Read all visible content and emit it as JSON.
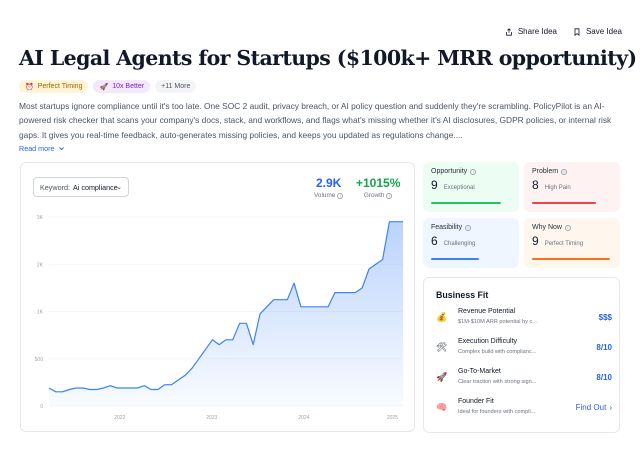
{
  "actions": {
    "share": "Share Idea",
    "save": "Save Idea"
  },
  "title": "AI Legal Agents for Startups ($100k+ MRR opportunity)",
  "badges": [
    {
      "icon": "alarm-clock-icon",
      "label": "Perfect Timing"
    },
    {
      "icon": "rocket-icon",
      "label": "10x Better"
    },
    {
      "label": "+11 More"
    }
  ],
  "description": "Most startups ignore compliance until it's too late. One SOC 2 audit, privacy breach, or AI policy question and suddenly they're scrambling. PolicyPilot is an AI-powered risk checker that scans your company's docs, stack, and workflows, and flags what's missing whether it's AI disclosures, GDPR policies, or internal risk gaps. It gives you real-time feedback, auto-generates missing policies, and keeps you updated as regulations change....",
  "read_more": "Read more",
  "trend": {
    "keyword_label": "Keyword:",
    "keyword_value": "Ai compliance",
    "volume_value": "2.9K",
    "volume_label": "Volume",
    "growth_value": "+1015%",
    "growth_label": "Growth"
  },
  "chart_data": {
    "type": "area",
    "y_ticks": [
      "3K",
      "2K",
      "1K",
      "500",
      "0"
    ],
    "x_ticks": [
      "2022",
      "2023",
      "2024",
      "2025"
    ],
    "color": "#3b82f6",
    "values": [
      380,
      300,
      300,
      350,
      380,
      380,
      350,
      350,
      380,
      430,
      380,
      380,
      380,
      380,
      430,
      350,
      350,
      450,
      450,
      550,
      650,
      800,
      1000,
      1200,
      1400,
      1300,
      1400,
      1400,
      1750,
      1750,
      1300,
      1950,
      2100,
      2250,
      2250,
      2250,
      2600,
      2100,
      2100,
      2100,
      2100,
      2100,
      2400,
      2400,
      2400,
      2400,
      2500,
      2900,
      3000,
      3100,
      3900,
      3900,
      3900
    ]
  },
  "scores": {
    "opportunity": {
      "title": "Opportunity",
      "value": "9",
      "label": "Exceptional"
    },
    "problem": {
      "title": "Problem",
      "value": "8",
      "label": "High Pain"
    },
    "feasibility": {
      "title": "Feasibility",
      "value": "6",
      "label": "Challenging"
    },
    "why_now": {
      "title": "Why Now",
      "value": "9",
      "label": "Perfect Timing"
    }
  },
  "business_fit": {
    "title": "Business Fit",
    "rows": [
      {
        "icon": "money-bag-icon",
        "name": "Revenue Potential",
        "sub": "$1M-$10M ARR potential by c...",
        "value": "$$$"
      },
      {
        "icon": "tools-icon",
        "name": "Execution Difficulty",
        "sub": "Complex build with complianc...",
        "value": "8/10"
      },
      {
        "icon": "rocket-icon",
        "name": "Go-To-Market",
        "sub": "Clear traction with strong sign...",
        "value": "8/10"
      },
      {
        "icon": "brain-icon",
        "name": "Founder Fit",
        "sub": "Ideal for founders with compli...",
        "value": "Find Out"
      }
    ]
  }
}
